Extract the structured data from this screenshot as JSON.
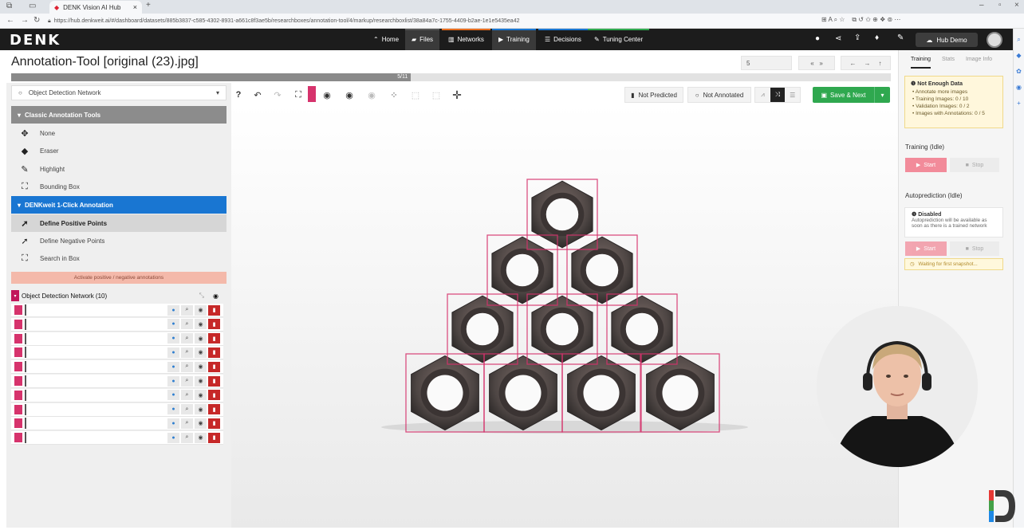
{
  "browser": {
    "tab_title": "DENK Vision AI Hub",
    "url": "https://hub.denkweit.ai/#/dashboard/datasets/885b3837-c585-4302-8931-a661c8f3ae5b/researchboxes/annotation-tool/4/markup/researchboxlist/38a84a7c-1755-4409-b2ae-1e1e5435ea42"
  },
  "nav": {
    "logo": "DENK",
    "home": "Home",
    "files": "Files",
    "networks": "Networks",
    "training": "Training",
    "decisions": "Decisions",
    "tuning": "Tuning Center",
    "hub_demo": "Hub Demo"
  },
  "page": {
    "title": "Annotation-Tool [original (23).jpg]",
    "page_input": "5",
    "progress_label": "5/11",
    "progress": 0.4545
  },
  "left": {
    "network_select": "Object Detection Network",
    "classic_header": "Classic Annotation Tools",
    "classic_tools": [
      "None",
      "Eraser",
      "Highlight",
      "Bounding Box"
    ],
    "oneclick_header": "DENKweit 1-Click Annotation",
    "oneclick_tools": [
      "Define Positive Points",
      "Define Negative Points",
      "Search in Box"
    ],
    "activate_label": "Activate positive / negative annotations",
    "network_list_label": "Object Detection Network (10)",
    "annotation_count": 10
  },
  "toolbar": {
    "not_predicted": "Not Predicted",
    "not_annotated": "Not Annotated",
    "save_next": "Save & Next"
  },
  "right": {
    "tabs": [
      "Training",
      "Stats",
      "Image Info"
    ],
    "warn_title": "Not Enough Data",
    "warn_items": [
      "Annotate more images",
      "Training Images: 0 / 10",
      "Validation Images: 0 / 2",
      "Images with Annotations: 0 / 5"
    ],
    "training_head": "Training (Idle)",
    "start": "Start",
    "stop": "Stop",
    "autoprediction_head": "Autoprediction (Idle)",
    "disabled_title": "Disabled",
    "disabled_text": "Autoprediction will be available as soon as there is a trained network",
    "waiting": "Waiting for first snapshot..."
  },
  "colors": {
    "nav_bg": "#1c1c1c",
    "annotation_pink": "#d6336c",
    "oneclick_blue": "#1976d2",
    "save_green": "#2fa84f",
    "start_pink": "#f28b9a"
  }
}
